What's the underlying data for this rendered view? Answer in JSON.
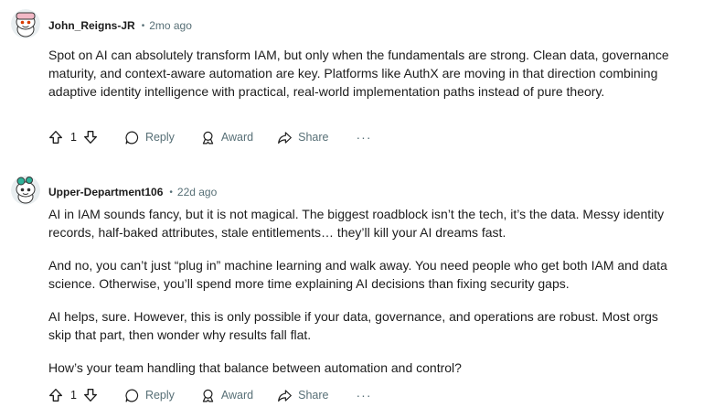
{
  "comments": [
    {
      "username": "John_Reigns-JR",
      "time": "2mo ago",
      "paragraphs": [
        "Spot on AI can absolutely transform IAM, but only when the fundamentals are strong. Clean data, governance maturity, and context-aware automation are key. Platforms like AuthX are moving in that direction combining adaptive identity intelligence with practical, real-world implementation paths instead of pure theory."
      ],
      "score": "1",
      "reply_label": "Reply",
      "award_label": "Award",
      "share_label": "Share",
      "more_label": "···",
      "avatar_color": "#f2b8c6"
    },
    {
      "username": "Upper-Department106",
      "time": "22d ago",
      "paragraphs": [
        "AI in IAM sounds fancy, but it is not magical. The biggest roadblock isn’t the tech, it’s the data. Messy identity records, half-baked attributes, stale entitlements… they’ll kill your AI dreams fast.",
        "And no, you can’t just “plug in” machine learning and walk away. You need people who get both IAM and data science. Otherwise, you’ll spend more time explaining AI decisions than fixing security gaps.",
        "AI helps, sure. However, this is only possible if your data, governance, and operations are robust. Most orgs skip that part, then wonder why results fall flat.",
        "How’s your team handling that balance between automation and control?"
      ],
      "score": "1",
      "reply_label": "Reply",
      "award_label": "Award",
      "share_label": "Share",
      "more_label": "···",
      "avatar_color": "#2fb39a"
    }
  ],
  "colors": {
    "meta_text": "#576f76",
    "body_text": "#1c1c1c"
  }
}
